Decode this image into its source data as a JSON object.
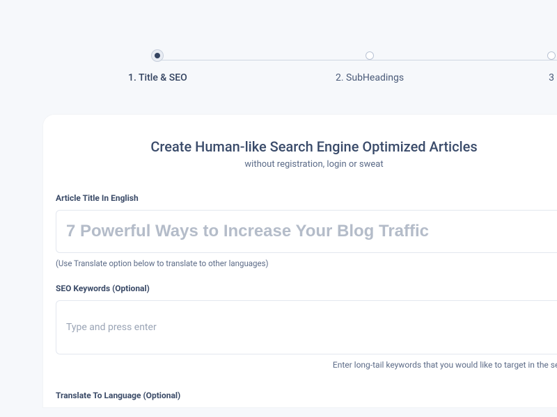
{
  "stepper": {
    "steps": [
      {
        "label": "1. Title & SEO",
        "active": true
      },
      {
        "label": "2. SubHeadings",
        "active": false
      },
      {
        "label": "3",
        "active": false
      }
    ]
  },
  "header": {
    "title": "Create Human-like Search Engine Optimized Articles",
    "subtitle": "without registration, login or sweat"
  },
  "titleField": {
    "label": "Article Title In English",
    "placeholder": "7 Powerful Ways to Increase Your Blog Traffic",
    "hint": "(Use Translate option below to translate to other languages)"
  },
  "keywordsField": {
    "label": "SEO Keywords (Optional)",
    "placeholder": "Type and press enter",
    "hint": "Enter long-tail keywords that you would like to target in the search re"
  },
  "translateField": {
    "label": "Translate To Language (Optional)"
  }
}
